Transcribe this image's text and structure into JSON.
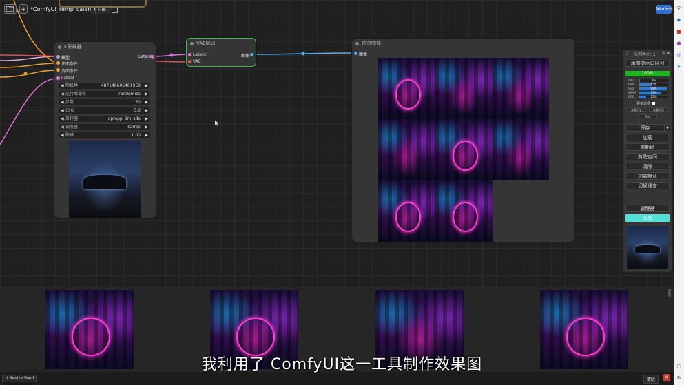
{
  "topbar": {
    "folder_icon": "folder-icon",
    "add_label": "+",
    "tab_title": "*ComfyUI_temp_caiah_00...",
    "file_label": "File",
    "models_label": "Models"
  },
  "ksampler": {
    "title": "K采样器",
    "inputs": [
      "模型",
      "正面条件",
      "负面条件",
      "Latent"
    ],
    "output": "Latent",
    "widgets": [
      {
        "label": "随机种",
        "value": "487148605481950"
      },
      {
        "label": "运行后操作",
        "value": "randomize"
      },
      {
        "label": "步数",
        "value": "30"
      },
      {
        "label": "CFG",
        "value": "5.0"
      },
      {
        "label": "采样器",
        "value": "dpmpp_3m_sde"
      },
      {
        "label": "调度器",
        "value": "karras"
      },
      {
        "label": "降噪",
        "value": "1.00"
      }
    ]
  },
  "vae_decode": {
    "title": "VAE解码",
    "inputs": [
      "Latent",
      "VAE"
    ],
    "output": "图像"
  },
  "preview": {
    "title": "预览图像",
    "input": "图像"
  },
  "queue_panel": {
    "title": "队列大小: 1",
    "add_prompt": "添加提示词队列",
    "progress": "100%",
    "progress_value": 1.0,
    "stats": [
      {
        "label": "CPU",
        "value": "3%",
        "fraction": 0.03
      },
      {
        "label": "RAM",
        "value": "45%",
        "fraction": 0.45
      },
      {
        "label": "GPU",
        "value": "99%",
        "fraction": 0.99
      },
      {
        "label": "VRAM",
        "value": "75%",
        "fraction": 0.75
      },
      {
        "label": "HDD",
        "value": "25%",
        "fraction": 0.25
      }
    ],
    "extra_options": "更多选项",
    "view_history": "查看历史",
    "view_queue": "查看队列",
    "gallery_btn": "图库",
    "buttons": [
      "保存",
      "加载",
      "重新刷",
      "剪贴空间",
      "清除",
      "加载默认",
      "切换语言"
    ],
    "manager": "管理器",
    "share": "分享"
  },
  "feed": {
    "resize_label": "Resize Feed",
    "clear_label": "清除",
    "close_icon": "close-icon"
  },
  "subtitle": "我利用了 ComfyUI这一工具制作效果图",
  "colors": {
    "accent": "#2c6fd6",
    "progress_green": "#1db41d",
    "share_cyan": "#4fe0d8",
    "vae_border": "#3fbf3f",
    "link_pink": "#e26fd9",
    "link_orange": "#f0a030",
    "link_blue": "#5aaee8"
  }
}
